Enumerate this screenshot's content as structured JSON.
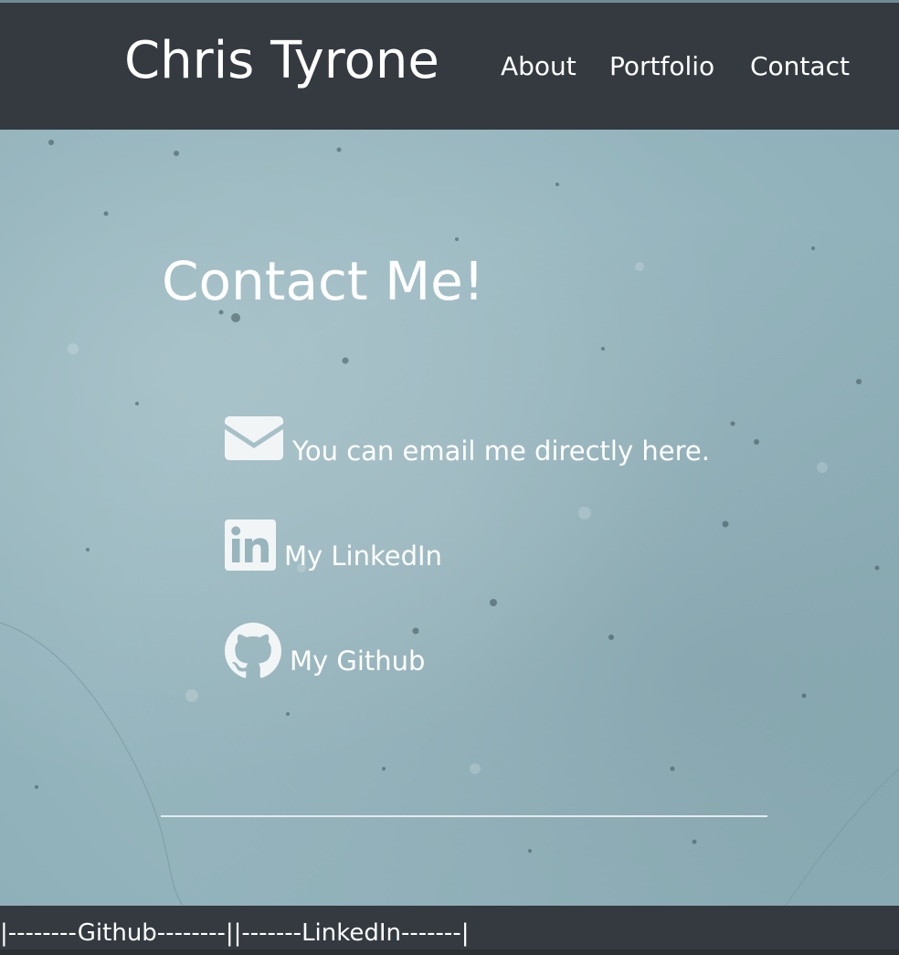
{
  "navbar": {
    "brand": "Chris Tyrone",
    "links": [
      {
        "label": "About"
      },
      {
        "label": "Portfolio"
      },
      {
        "label": "Contact"
      }
    ]
  },
  "main": {
    "heading": "Contact Me!",
    "contacts": [
      {
        "icon": "envelope-icon",
        "label": "You can email me directly here."
      },
      {
        "icon": "linkedin-icon",
        "label": "My LinkedIn"
      },
      {
        "icon": "github-icon",
        "label": "My Github"
      }
    ]
  },
  "footer": {
    "pipe_left": "|",
    "github_link": "--------Github--------",
    "pipe_middle": "||",
    "linkedin_link": "-------LinkedIn-------",
    "pipe_right": "|"
  },
  "colors": {
    "navbar_bg": "#343a40",
    "hero_bg": "#98b5bd",
    "text": "#ffffff"
  }
}
